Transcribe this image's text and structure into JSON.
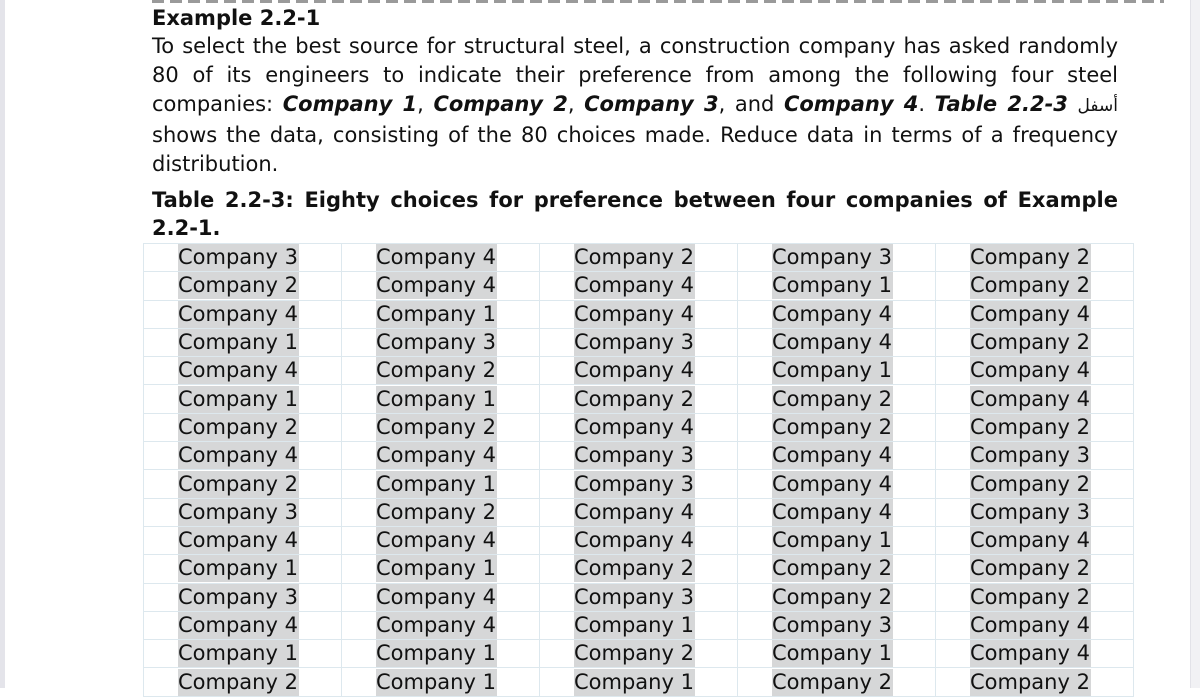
{
  "example": {
    "title": "Example 2.2-1",
    "text_part1": "To select the best source for structural steel, a construction company has asked randomly 80 of its engineers to indicate their preference from among the following four steel companies: ",
    "company1": "Company 1",
    "sep1": ", ",
    "company2": "Company 2",
    "sep2": ", ",
    "company3": "Company 3",
    "sep3": ", and ",
    "company4": "Company 4",
    "sep4": ". ",
    "table_ref": "Table 2.2-3",
    "arabic_word": "أسفل",
    "text_part2": " shows the data, consisting of the 80 choices made. Reduce data in terms of a frequency distribution."
  },
  "table": {
    "caption": "Table 2.2-3: Eighty choices for preference between four companies of Example 2.2-1.",
    "rows": [
      [
        "Company 3",
        "Company 4",
        "Company 2",
        "Company 3",
        "Company 2"
      ],
      [
        "Company 2",
        "Company 4",
        "Company 4",
        "Company 1",
        "Company 2"
      ],
      [
        "Company 4",
        "Company 1",
        "Company 4",
        "Company 4",
        "Company 4"
      ],
      [
        "Company 1",
        "Company 3",
        "Company 3",
        "Company 4",
        "Company 2"
      ],
      [
        "Company 4",
        "Company 2",
        "Company 4",
        "Company 1",
        "Company 4"
      ],
      [
        "Company 1",
        "Company 1",
        "Company 2",
        "Company 2",
        "Company 4"
      ],
      [
        "Company 2",
        "Company 2",
        "Company 4",
        "Company 2",
        "Company 2"
      ],
      [
        "Company 4",
        "Company 4",
        "Company 3",
        "Company 4",
        "Company 3"
      ],
      [
        "Company 2",
        "Company 1",
        "Company 3",
        "Company 4",
        "Company 2"
      ],
      [
        "Company 3",
        "Company 2",
        "Company 4",
        "Company 4",
        "Company 3"
      ],
      [
        "Company 4",
        "Company 4",
        "Company 4",
        "Company 1",
        "Company 4"
      ],
      [
        "Company 1",
        "Company 1",
        "Company 2",
        "Company 2",
        "Company 2"
      ],
      [
        "Company 3",
        "Company 4",
        "Company 3",
        "Company 2",
        "Company 2"
      ],
      [
        "Company 4",
        "Company 4",
        "Company 1",
        "Company 3",
        "Company 4"
      ],
      [
        "Company 1",
        "Company 1",
        "Company 2",
        "Company 1",
        "Company 4"
      ],
      [
        "Company 2",
        "Company 1",
        "Company 1",
        "Company 2",
        "Company 2"
      ]
    ]
  }
}
